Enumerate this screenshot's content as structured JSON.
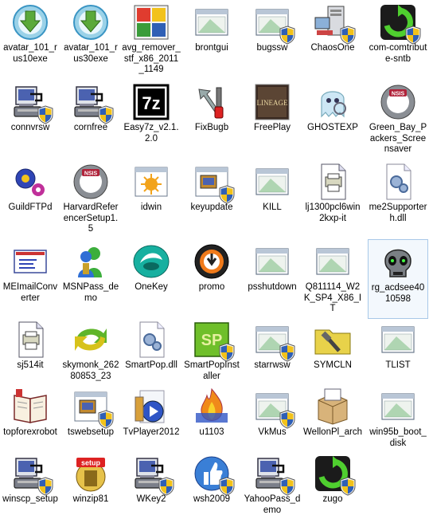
{
  "desktop": {
    "icons": [
      {
        "label": "avatar_101_rus10exe",
        "icon": "download-arrow-icon",
        "shield": false
      },
      {
        "label": "avatar_101_rus30exe",
        "icon": "download-arrow-icon",
        "shield": false
      },
      {
        "label": "avg_remover_stf_x86_2011_1149",
        "icon": "avg-icon",
        "shield": false
      },
      {
        "label": "brontgui",
        "icon": "window-icon",
        "shield": false
      },
      {
        "label": "bugssw",
        "icon": "window-icon",
        "shield": true
      },
      {
        "label": "ChaosOne",
        "icon": "computer-icon",
        "shield": true
      },
      {
        "label": "com-comtribute-sntb",
        "icon": "green-refresh-icon",
        "shield": true
      },
      {
        "label": "connvrsw",
        "icon": "installer-icon",
        "shield": true
      },
      {
        "label": "cornfree",
        "icon": "installer-icon",
        "shield": true
      },
      {
        "label": "Easy7z_v2.1.2.0",
        "icon": "7z-icon",
        "shield": false
      },
      {
        "label": "FixBugb",
        "icon": "tools-icon",
        "shield": false
      },
      {
        "label": "FreePlay",
        "icon": "lineage-icon",
        "shield": false
      },
      {
        "label": "GHOSTEXP",
        "icon": "ghost-icon",
        "shield": false
      },
      {
        "label": "Green_Bay_Packers_Screensaver",
        "icon": "nss-icon",
        "shield": false
      },
      {
        "label": "GuildFTPd",
        "icon": "gears-icon",
        "shield": false
      },
      {
        "label": "HarvardReferencerSetup1.5",
        "icon": "nss-icon",
        "shield": false
      },
      {
        "label": "idwin",
        "icon": "sun-window-icon",
        "shield": false
      },
      {
        "label": "keyupdate",
        "icon": "installer-window-icon",
        "shield": true
      },
      {
        "label": "KILL",
        "icon": "window-icon",
        "shield": false
      },
      {
        "label": "lj1300pcl6win2kxp-it",
        "icon": "printer-document-icon",
        "shield": false
      },
      {
        "label": "me2Supporterh.dll",
        "icon": "dll-gear-icon",
        "shield": false
      },
      {
        "label": "MEImailConverter",
        "icon": "mail-icon",
        "shield": false
      },
      {
        "label": "MSNPass_demo",
        "icon": "msn-icon",
        "shield": false
      },
      {
        "label": "OneKey",
        "icon": "onekey-icon",
        "shield": false
      },
      {
        "label": "promo",
        "icon": "power-icon",
        "shield": false
      },
      {
        "label": "psshutdown",
        "icon": "window-icon",
        "shield": false
      },
      {
        "label": "Q811114_W2K_SP4_X86_IT",
        "icon": "window-icon",
        "shield": false
      },
      {
        "label": "rg_acdsee4010598",
        "icon": "skull-icon",
        "shield": false
      },
      {
        "label": "sj514it",
        "icon": "printer-document-icon",
        "shield": false
      },
      {
        "label": "skymonk_26280853_23",
        "icon": "skymonk-icon",
        "shield": false
      },
      {
        "label": "SmartPop.dll",
        "icon": "dll-gear-icon",
        "shield": false
      },
      {
        "label": "SmartPopInstaller",
        "icon": "sp-icon",
        "shield": true
      },
      {
        "label": "starrwsw",
        "icon": "window-icon",
        "shield": true
      },
      {
        "label": "SYMCLN",
        "icon": "symcln-icon",
        "shield": false
      },
      {
        "label": "TLIST",
        "icon": "window-icon",
        "shield": false
      },
      {
        "label": "topforexrobot",
        "icon": "book-icon",
        "shield": false
      },
      {
        "label": "tswebsetup",
        "icon": "installer-window-icon",
        "shield": true
      },
      {
        "label": "TvPlayer2012",
        "icon": "tvplayer-icon",
        "shield": false
      },
      {
        "label": "u1103",
        "icon": "flame-icon",
        "shield": false
      },
      {
        "label": "VkMus",
        "icon": "window-icon",
        "shield": true
      },
      {
        "label": "WellonPl_arch",
        "icon": "box-icon",
        "shield": false
      },
      {
        "label": "win95b_boot_disk",
        "icon": "window-icon",
        "shield": false
      },
      {
        "label": "winscp_setup",
        "icon": "installer-icon",
        "shield": true
      },
      {
        "label": "winzip81",
        "icon": "setup-icon",
        "shield": false
      },
      {
        "label": "WKey2",
        "icon": "installer-icon",
        "shield": true
      },
      {
        "label": "wsh2009",
        "icon": "thumbsup-icon",
        "shield": true
      },
      {
        "label": "YahooPass_demo",
        "icon": "installer-icon",
        "shield": true
      },
      {
        "label": "zugo",
        "icon": "green-refresh-icon",
        "shield": true
      }
    ],
    "selected_index": 27,
    "colors": {
      "selection_border": "#a8c8e8",
      "selection_fill": "#f3f8fd",
      "shield_blue": "#2f5fb5",
      "shield_yellow": "#f2c21b"
    }
  }
}
